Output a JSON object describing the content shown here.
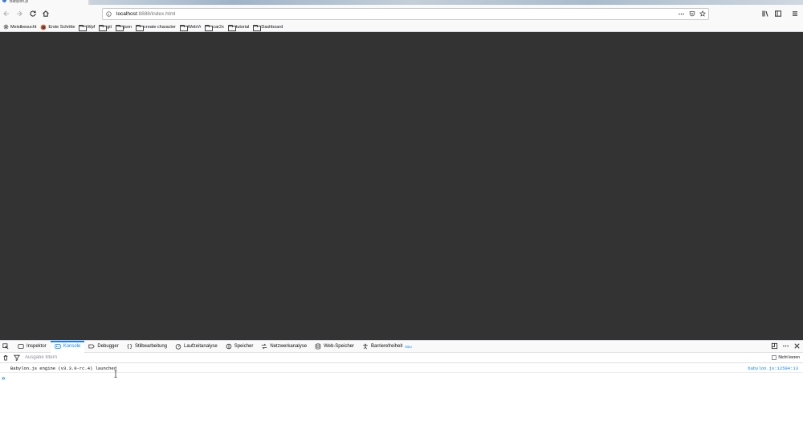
{
  "browser": {
    "tab_title": "Babylon.js",
    "url": {
      "host": "localhost",
      "path": ":8888/index.html"
    }
  },
  "bookmarks": [
    {
      "label": "Meistbesucht",
      "icon": "gear-icon"
    },
    {
      "label": "Erste Schritte",
      "icon": "firefox-icon"
    },
    {
      "label": "Wpf",
      "icon": "folder-icon"
    },
    {
      "label": "git",
      "icon": "folder-icon"
    },
    {
      "label": "json",
      "icon": "folder-icon"
    },
    {
      "label": "create character",
      "icon": "folder-icon"
    },
    {
      "label": "WebVr",
      "icon": "folder-icon"
    },
    {
      "label": "car2x",
      "icon": "folder-icon"
    },
    {
      "label": "tutorial",
      "icon": "folder-icon"
    },
    {
      "label": "Dashboard",
      "icon": "folder-icon"
    }
  ],
  "devtools": {
    "tabs": [
      {
        "label": "Inspektor",
        "icon": "inspector-icon",
        "active": false
      },
      {
        "label": "Konsole",
        "icon": "console-icon",
        "active": true
      },
      {
        "label": "Debugger",
        "icon": "debugger-icon",
        "active": false
      },
      {
        "label": "Stilbearbeitung",
        "icon": "braces-icon",
        "active": false
      },
      {
        "label": "Laufzeitanalyse",
        "icon": "performance-icon",
        "active": false
      },
      {
        "label": "Speicher",
        "icon": "memory-icon",
        "active": false
      },
      {
        "label": "Netzwerkanalyse",
        "icon": "network-icon",
        "active": false
      },
      {
        "label": "Web-Speicher",
        "icon": "storage-icon",
        "active": false
      },
      {
        "label": "Barrierefreiheit",
        "icon": "accessibility-icon",
        "active": false,
        "badge": "Neu"
      }
    ],
    "filter": {
      "placeholder": "Ausgabe filtern",
      "persist_label": "Nicht leeren"
    },
    "messages": [
      {
        "text": "Babylon.js engine (v3.3.0-rc.4) launched",
        "source": "babylon.js:12594:13"
      }
    ]
  },
  "colors": {
    "viewport_bg": "#333333",
    "accent": "#0a84ff"
  }
}
